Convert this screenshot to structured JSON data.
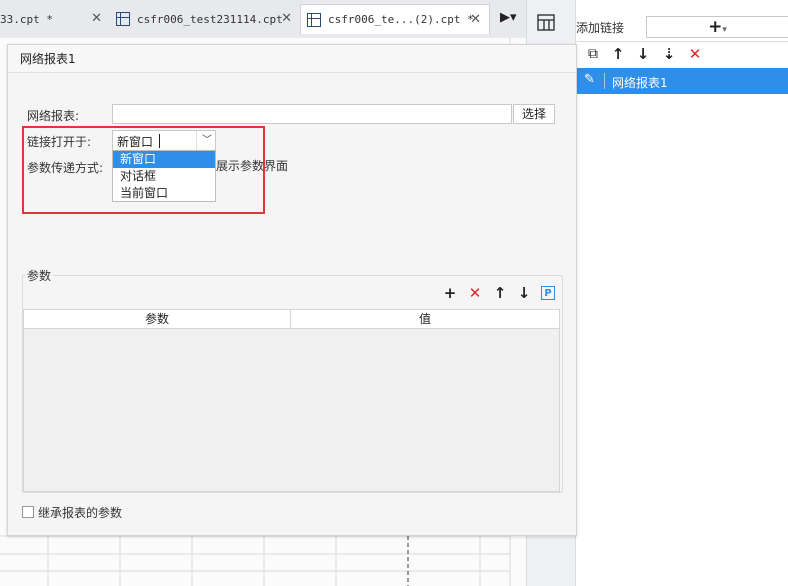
{
  "tabs": [
    {
      "label": "33.cpt *",
      "active": false
    },
    {
      "label": "csfr006_test231114.cpt",
      "active": false
    },
    {
      "label": "csfr006_te...(2).cpt *",
      "active": true
    }
  ],
  "dialog": {
    "title": "网络报表1",
    "report_label": "网络报表:",
    "report_value": "",
    "select_button": "选择",
    "open_in_label": "链接打开于:",
    "open_in_value": "新窗口",
    "open_in_options": [
      "新窗口",
      "对话框",
      "当前窗口"
    ],
    "open_in_selected_index": 0,
    "param_pass_label": "参数传递方式:",
    "param_pass_suffix": "展示参数界面",
    "params_group_label": "参数",
    "params_columns": [
      "参数",
      "值"
    ],
    "inherit_params_label": "继承报表的参数",
    "inherit_params_checked": false
  },
  "right_panel": {
    "add_link_label": "添加链接",
    "links": [
      {
        "label": "网络报表1",
        "selected": true
      }
    ]
  },
  "colors": {
    "accent": "#2f8ee8",
    "highlight": "#e1343b",
    "delete": "#e0282e"
  }
}
